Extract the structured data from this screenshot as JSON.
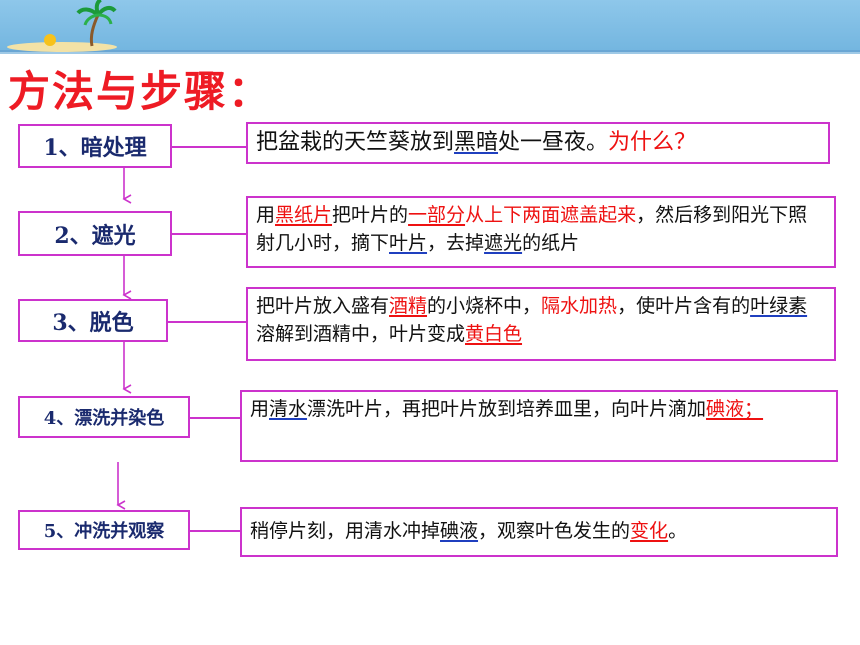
{
  "title": "方法与步骤：",
  "colors": {
    "accent": "#ee1b24",
    "border": "#cc33cc",
    "step_text": "#1a2a6e",
    "banner": "#7fbfe6"
  },
  "steps": [
    {
      "label": "1、暗处理"
    },
    {
      "label": "2、遮光"
    },
    {
      "label": "3、脱色"
    },
    {
      "label": "4、漂洗并染色"
    },
    {
      "label": "5、冲洗并观察"
    }
  ],
  "descriptions": {
    "s1": {
      "p1": "把盆栽的天竺葵放到",
      "p2": "黑暗",
      "p3": "处一昼夜。",
      "p4": "为什么？"
    },
    "s2": {
      "p1": "用",
      "p2": "黑纸片",
      "p3": "把叶片的",
      "p4": "一部分",
      "p5": "从上下两面遮盖起来",
      "p6": "，然后移到阳光下照射几小时，摘下",
      "p7": "叶片",
      "p8": "，去掉",
      "p9": "遮光",
      "p10": "的纸片"
    },
    "s3": {
      "p1": "把叶片放入盛有",
      "p2": "酒精",
      "p3": "的小烧杯中，",
      "p4": "隔水加热",
      "p5": "，使叶片含有的",
      "p6": "叶绿素",
      "p7": "溶解到酒精中，叶片变成",
      "p8": "黄白色"
    },
    "s4": {
      "p1": "用",
      "p2": "清水",
      "p3": "漂洗叶片，再把叶片放到培养皿里，向叶片滴加",
      "p4": "碘液；"
    },
    "s5": {
      "p1": "稍停片刻，用清水冲掉",
      "p2": "碘液",
      "p3": "，观察叶色发生的",
      "p4": "变化",
      "p5": "。"
    }
  }
}
